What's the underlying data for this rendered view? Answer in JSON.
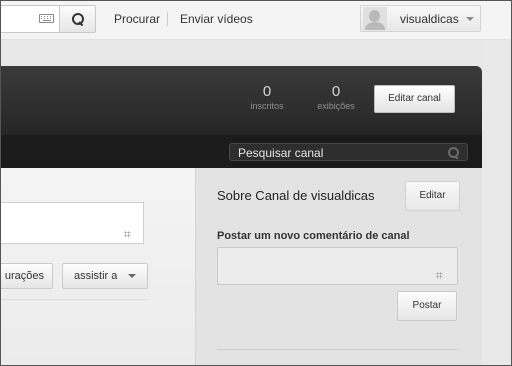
{
  "masthead": {
    "search_icon": "search-icon",
    "keyboard_icon": "keyboard-icon",
    "nav_browse": "Procurar",
    "nav_upload": "Enviar vídeos",
    "user_name": "visualdicas"
  },
  "channel": {
    "subscribers_count": "0",
    "subscribers_label": "inscritos",
    "views_count": "0",
    "views_label": "exibições",
    "edit_channel_label": "Editar canal",
    "search_placeholder": "Pesquisar canal"
  },
  "left": {
    "settings_label": "urações",
    "watch_label": "assistir a"
  },
  "right": {
    "about_title": "Sobre Canal de visualdicas",
    "edit_label": "Editar",
    "post_heading": "Postar um novo comentário de canal",
    "post_button_label": "Postar"
  }
}
